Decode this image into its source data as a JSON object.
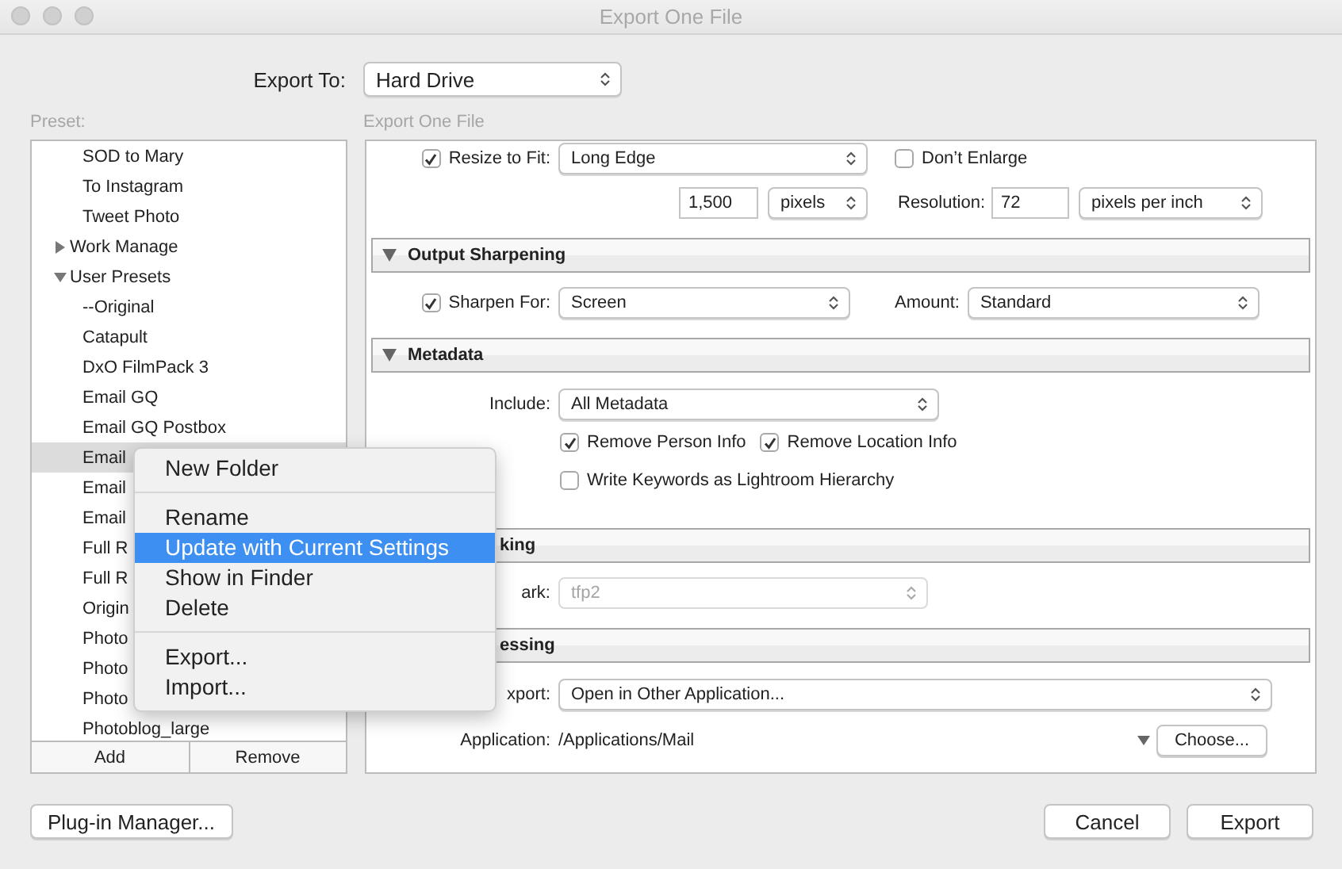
{
  "window": {
    "title": "Export One File"
  },
  "export_to": {
    "label": "Export To:",
    "value": "Hard Drive"
  },
  "preset": {
    "label": "Preset:",
    "items": [
      {
        "label": "SOD to Mary",
        "selected": false
      },
      {
        "label": "To Instagram",
        "selected": false
      },
      {
        "label": "Tweet Photo",
        "selected": false
      },
      {
        "label": "Work Manage",
        "selected": false,
        "expanded": false
      },
      {
        "label": "User Presets",
        "selected": false,
        "expanded": true,
        "children": [
          {
            "label": "--Original",
            "selected": false
          },
          {
            "label": "Catapult",
            "selected": false
          },
          {
            "label": "DxO FilmPack 3",
            "selected": false
          },
          {
            "label": "Email GQ",
            "selected": false
          },
          {
            "label": "Email GQ Postbox",
            "selected": false
          },
          {
            "label": "Email",
            "selected": true
          },
          {
            "label": "Email",
            "selected": false
          },
          {
            "label": "Email",
            "selected": false
          },
          {
            "label": "Full R",
            "selected": false
          },
          {
            "label": "Full R",
            "selected": false
          },
          {
            "label": "Origin",
            "selected": false
          },
          {
            "label": "Photo",
            "selected": false
          },
          {
            "label": "Photo",
            "selected": false
          },
          {
            "label": "Photo",
            "selected": false
          },
          {
            "label": "Photoblog_large",
            "selected": false
          }
        ]
      }
    ],
    "buttons": [
      "Add",
      "Remove"
    ]
  },
  "panel": {
    "label": "Export One File",
    "sections": [
      {
        "rows": [
          {
            "lead": {
              "kind": "checkbox",
              "label": "Resize to Fit:",
              "checked": true
            },
            "controls": [
              {
                "kind": "select",
                "value": "Long Edge"
              },
              {
                "kind": "checkbox",
                "label": "Don’t Enlarge",
                "checked": false
              }
            ]
          },
          {
            "controls": [
              {
                "kind": "field",
                "value": "1,500"
              },
              {
                "kind": "select",
                "value": "pixels"
              },
              {
                "kind": "label",
                "text": "Resolution:"
              },
              {
                "kind": "field",
                "value": "72"
              },
              {
                "kind": "select",
                "value": "pixels per inch"
              }
            ]
          }
        ]
      },
      {
        "title": "Output Sharpening",
        "kind": "full",
        "expanded": true,
        "rows": [
          {
            "lead": {
              "kind": "checkbox",
              "label": "Sharpen For:",
              "checked": true
            },
            "controls": [
              {
                "kind": "select",
                "value": "Screen"
              },
              {
                "kind": "label",
                "text": "Amount:"
              },
              {
                "kind": "select",
                "value": "Standard"
              }
            ]
          }
        ]
      },
      {
        "title": "Metadata",
        "kind": "full",
        "expanded": true,
        "rows": [
          {
            "lead": {
              "kind": "label",
              "text": "Include:"
            },
            "controls": [
              {
                "kind": "select",
                "value": "All Metadata"
              }
            ]
          },
          {
            "controls": [
              {
                "kind": "checkbox",
                "label": "Remove Person Info",
                "checked": true
              },
              {
                "kind": "checkbox",
                "label": "Remove Location Info",
                "checked": true
              }
            ]
          },
          {
            "controls": [
              {
                "kind": "checkbox",
                "label": "Write Keywords as Lightroom Hierarchy",
                "checked": false
              }
            ]
          }
        ]
      },
      {
        "title": "king",
        "kind": "clipped",
        "expanded": true,
        "rows": [
          {
            "lead": {
              "kind": "label",
              "text": "ark:"
            },
            "controls": [
              {
                "kind": "select",
                "value": "tfp2",
                "disabled": true
              }
            ]
          }
        ]
      },
      {
        "title": "essing",
        "kind": "clipped",
        "expanded": true,
        "rows": [
          {
            "lead": {
              "kind": "label",
              "text": "xport:"
            },
            "controls": [
              {
                "kind": "select",
                "value": "Open in Other Application..."
              }
            ]
          },
          {
            "lead": {
              "kind": "label",
              "text": "Application:"
            },
            "controls": [
              {
                "kind": "path",
                "text": "/Applications/Mail"
              },
              {
                "kind": "popup"
              },
              {
                "kind": "button",
                "label": "Choose..."
              }
            ]
          }
        ]
      }
    ]
  },
  "context_menu": {
    "groups": [
      [
        {
          "label": "New Folder",
          "selected": false
        }
      ],
      [
        {
          "label": "Rename",
          "selected": false
        },
        {
          "label": "Update with Current Settings",
          "selected": true
        },
        {
          "label": "Show in Finder",
          "selected": false
        },
        {
          "label": "Delete",
          "selected": false
        }
      ],
      [
        {
          "label": "Export...",
          "selected": false
        },
        {
          "label": "Import...",
          "selected": false
        }
      ]
    ]
  },
  "footer": {
    "left": [
      "Plug-in Manager..."
    ],
    "right": [
      "Cancel",
      "Export"
    ]
  }
}
